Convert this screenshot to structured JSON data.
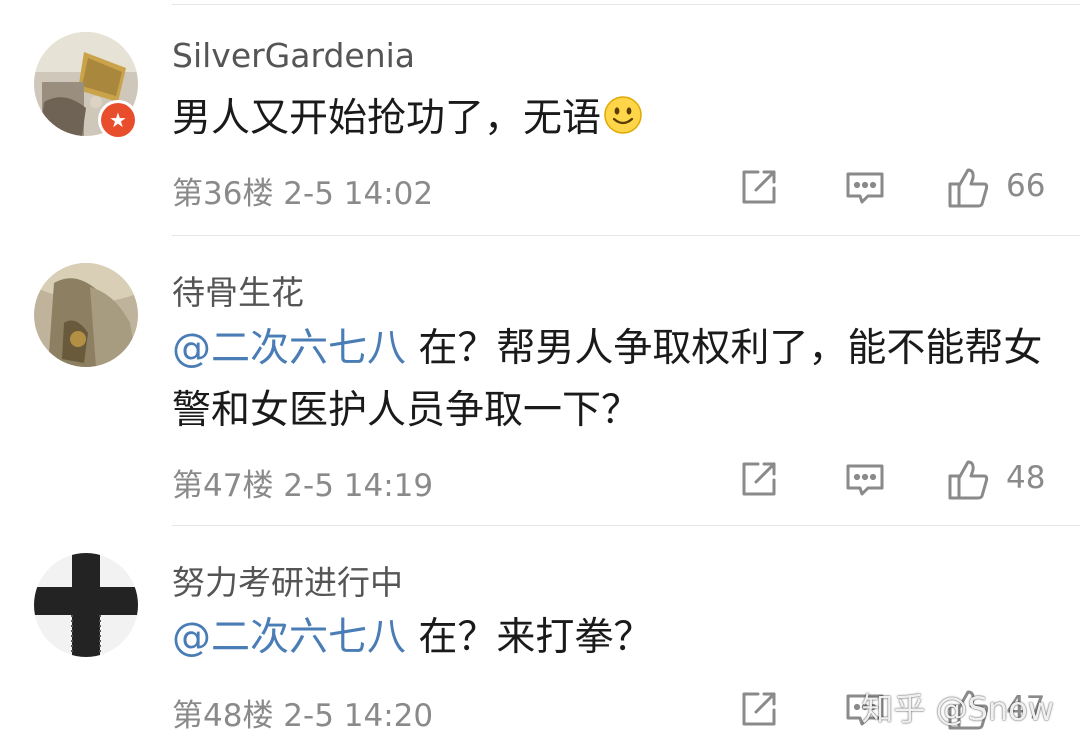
{
  "comments": [
    {
      "username": "SilverGardenia",
      "mention": "",
      "text": "男人又开始抢功了，无语",
      "emoji": "slight-smile-emoji",
      "floor_time": "第36楼  2-5 14:02",
      "likes": "66",
      "avatar_badge": "★"
    },
    {
      "username": "待骨生花",
      "mention": "@二次六七八",
      "text": " 在？帮男人争取权利了，能不能帮女警和女医护人员争取一下？",
      "floor_time": "第47楼  2-5 14:19",
      "likes": "48"
    },
    {
      "username": "努力考研进行中",
      "mention": "@二次六七八",
      "text": " 在？来打拳？",
      "floor_time": "第48楼  2-5 14:20",
      "likes": "47"
    }
  ],
  "icons": {
    "share": "share-icon",
    "reply": "comment-icon",
    "like": "thumbs-up-icon"
  },
  "watermark": "知乎 @Snow",
  "colors": {
    "mention": "#4a7db5",
    "meta": "#8a8a8a",
    "divider": "#e6e6e6",
    "badge": "#e94e2c"
  }
}
